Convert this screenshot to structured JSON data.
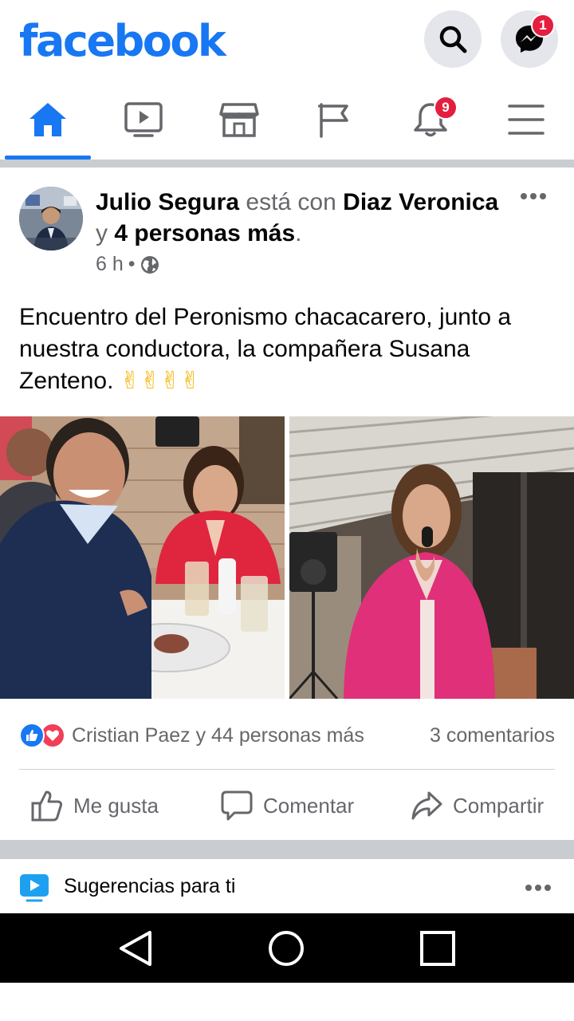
{
  "header": {
    "logo": "facebook",
    "messenger_badge": "1"
  },
  "tabs": {
    "notifications_badge": "9"
  },
  "post": {
    "author": "Julio Segura",
    "with_text": "está con",
    "tagged_name": "Diaz Veronica",
    "and_text": "y",
    "others": "4 personas más",
    "period": ".",
    "time": "6 h",
    "dot": "•",
    "text": "Encuentro del Peronismo chacacarero, junto a nuestra conductora, la compañera Susana Zenteno.",
    "emojis": "✌✌✌✌",
    "reactions_text": "Cristian Paez y 44 personas más",
    "comments_count": "3 comentarios",
    "actions": {
      "like": "Me gusta",
      "comment": "Comentar",
      "share": "Compartir"
    }
  },
  "suggestions": {
    "title": "Sugerencias para ti"
  },
  "colors": {
    "brand": "#1877f2",
    "badge": "#e41e3f",
    "love": "#f33e58"
  }
}
